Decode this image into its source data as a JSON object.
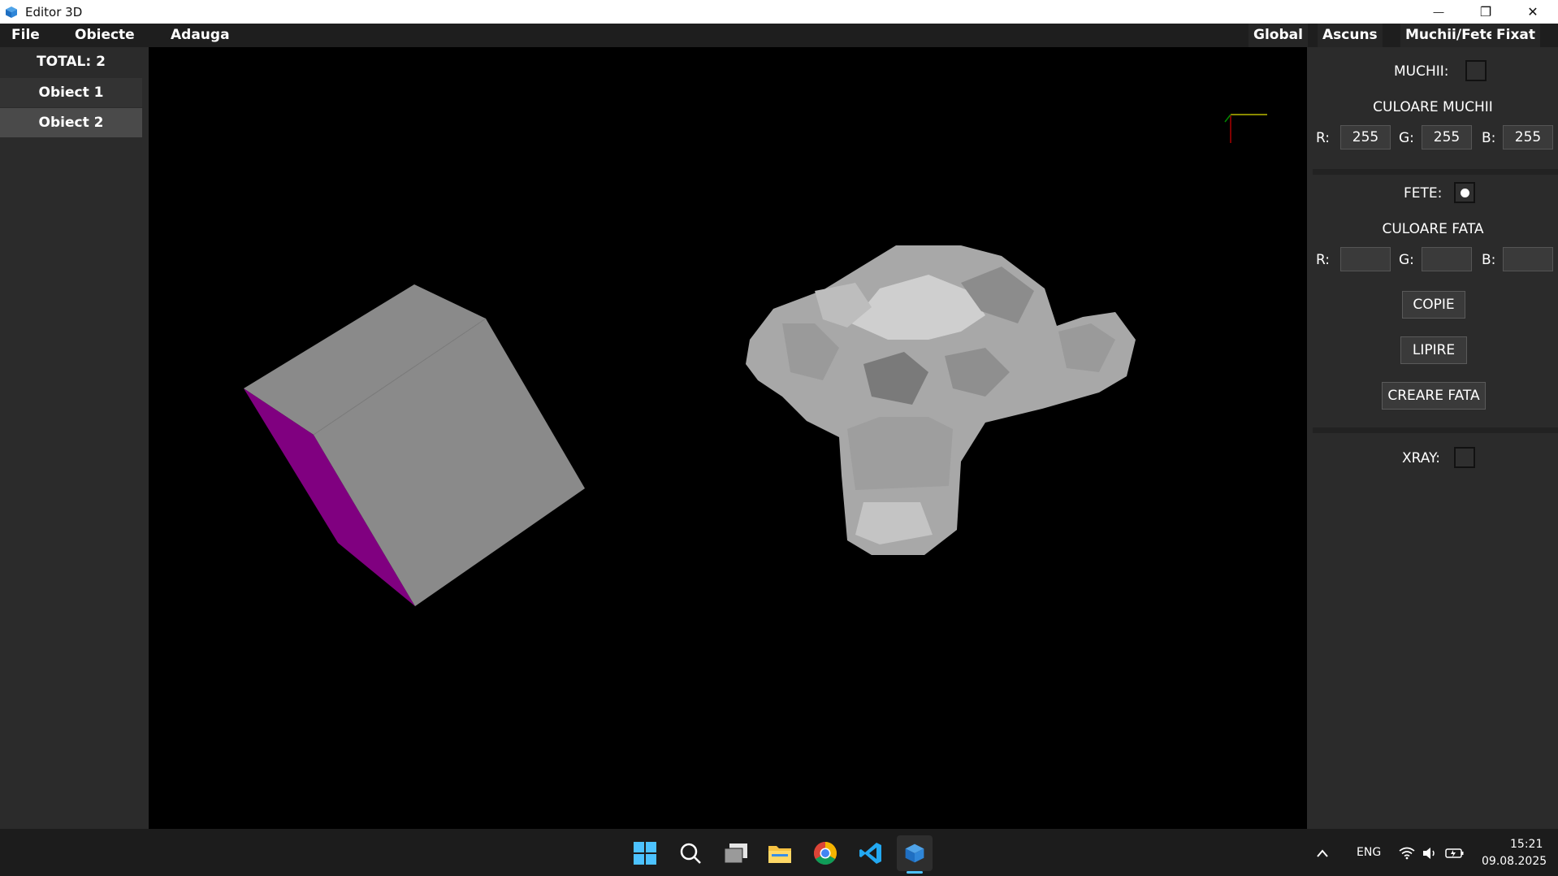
{
  "window": {
    "title": "Editor 3D",
    "minimize_glyph": "—",
    "restore_glyph": "❐",
    "close_glyph": "✕"
  },
  "menu": {
    "file": "File",
    "obiecte": "Obiecte",
    "adauga": "Adauga",
    "global": "Global",
    "ascuns": "Ascuns",
    "muchii_fete": "Muchii/Fete",
    "fixat": "Fixat"
  },
  "objects_panel": {
    "total": "TOTAL: 2",
    "items": [
      {
        "label": "Obiect 1",
        "selected": false
      },
      {
        "label": "Obiect 2",
        "selected": true
      }
    ]
  },
  "properties": {
    "muchii_label": "MUCHII:",
    "muchii_checked": false,
    "culoare_muchii_title": "CULOARE MUCHII",
    "edge_color": {
      "r_label": "R:",
      "g_label": "G:",
      "b_label": "B:",
      "r": "255",
      "g": "255",
      "b": "255"
    },
    "fete_label": "FETE:",
    "fete_checked": true,
    "culoare_fata_title": "CULOARE FATA",
    "face_color": {
      "r_label": "R:",
      "g_label": "G:",
      "b_label": "B:",
      "r": "",
      "g": "",
      "b": ""
    },
    "copie_button": "COPIE",
    "lipire_button": "LIPIRE",
    "creare_fata_button": "CREARE FATA",
    "xray_label": "XRAY:",
    "xray_checked": false
  },
  "viewport": {
    "objects": [
      "cube",
      "monkey-head"
    ],
    "cube_side_color": "#800080",
    "cube_face_color": "#8a8a8a",
    "background": "#000000"
  },
  "taskbar": {
    "icons": [
      "windows-start-icon",
      "search-icon",
      "task-view-icon",
      "file-explorer-icon",
      "chrome-icon",
      "vscode-icon",
      "editor-3d-icon"
    ],
    "language": "ENG",
    "time": "15:21",
    "date": "09.08.2025"
  }
}
